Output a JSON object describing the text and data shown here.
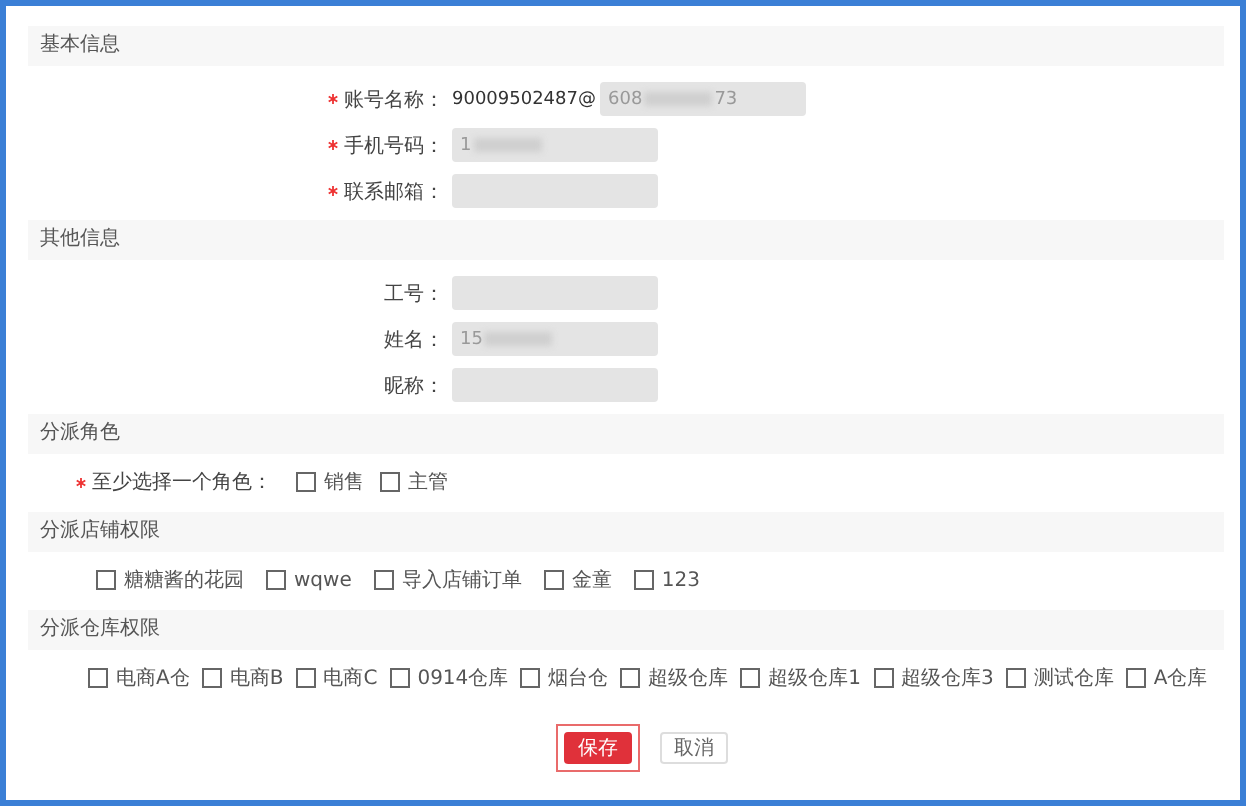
{
  "sections": [
    {
      "title": "基本信息",
      "kind": "fields",
      "fields": [
        {
          "label": "账号名称：",
          "required": true,
          "fixed_text": "90009502487@",
          "value_prefix": "608",
          "value_suffix": "73",
          "redacted": true
        },
        {
          "label": "手机号码：",
          "required": true,
          "value_prefix": "1",
          "redacted": true
        },
        {
          "label": "联系邮箱：",
          "required": true
        }
      ]
    },
    {
      "title": "其他信息",
      "kind": "fields",
      "fields": [
        {
          "label": "工号：",
          "required": false
        },
        {
          "label": "姓名：",
          "required": false,
          "value_prefix": "15",
          "redacted": true
        },
        {
          "label": "昵称：",
          "required": false
        }
      ]
    },
    {
      "title": "分派角色",
      "kind": "checks",
      "label": "至少选择一个角色：",
      "required": true,
      "options": [
        {
          "label": "销售",
          "checked": false
        },
        {
          "label": "主管",
          "checked": false
        }
      ]
    },
    {
      "title": "分派店铺权限",
      "kind": "checks",
      "options": [
        {
          "label": "糖糖酱的花园",
          "checked": false
        },
        {
          "label": "wqwe",
          "checked": false
        },
        {
          "label": "导入店铺订单",
          "checked": false
        },
        {
          "label": "金童",
          "checked": false
        },
        {
          "label": "123",
          "checked": false
        }
      ]
    },
    {
      "title": "分派仓库权限",
      "kind": "checks",
      "options": [
        {
          "label": "电商A仓",
          "checked": false
        },
        {
          "label": "电商B",
          "checked": false
        },
        {
          "label": "电商C",
          "checked": false
        },
        {
          "label": "0914仓库",
          "checked": false
        },
        {
          "label": "烟台仓",
          "checked": false
        },
        {
          "label": "超级仓库",
          "checked": false
        },
        {
          "label": "超级仓库1",
          "checked": false
        },
        {
          "label": "超级仓库3",
          "checked": false
        },
        {
          "label": "测试仓库",
          "checked": false
        },
        {
          "label": "A仓库",
          "checked": false
        }
      ]
    }
  ],
  "buttons": [
    {
      "label": "保存",
      "kind": "primary",
      "highlighted": true
    },
    {
      "label": "取消",
      "kind": "secondary",
      "highlighted": false
    }
  ]
}
